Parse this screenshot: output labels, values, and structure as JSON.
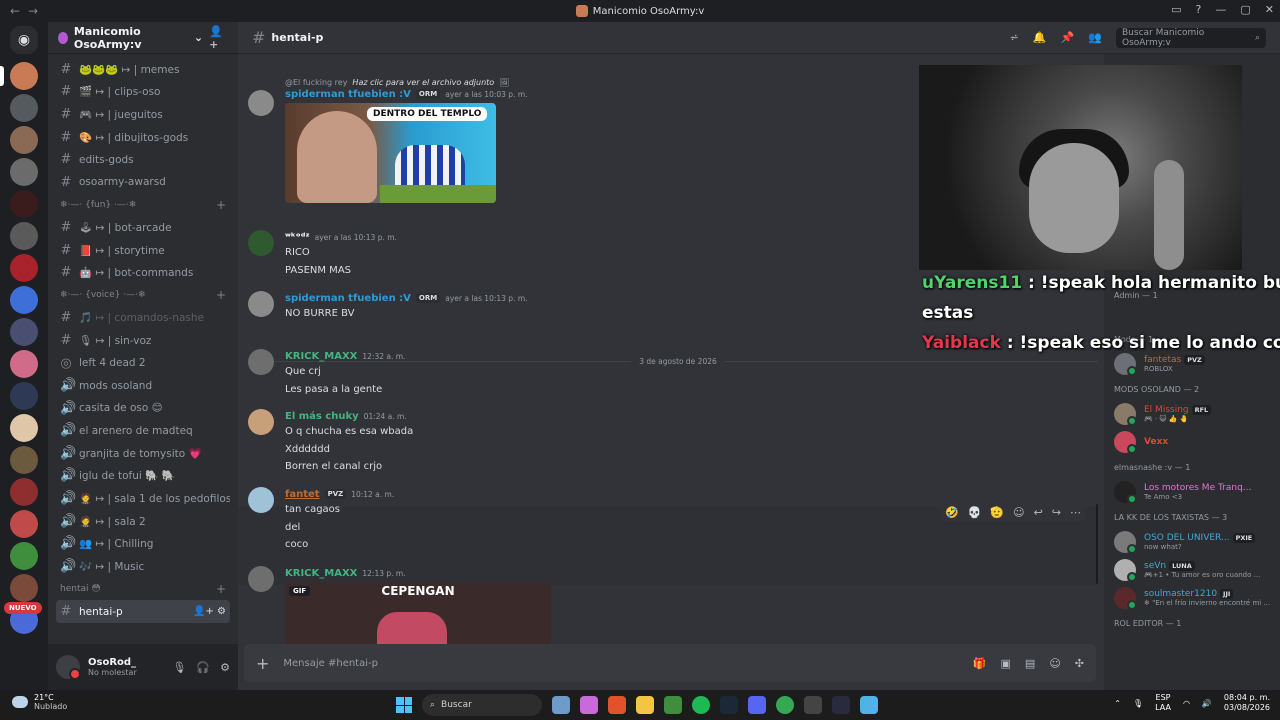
{
  "window": {
    "title": "Manicomio OsoArmy:v",
    "controls": [
      "▭",
      "?",
      "—",
      "▢",
      "✕"
    ]
  },
  "server": {
    "name": "Manicomio OsoArmy:v"
  },
  "channels": [
    {
      "kind": "text",
      "label": "🐸🐸🐸 ↦ | memes"
    },
    {
      "kind": "text",
      "label": "🎬 ↦ | clips-oso"
    },
    {
      "kind": "text",
      "label": "🎮 ↦ | jueguitos"
    },
    {
      "kind": "text",
      "label": "🎨 ↦ | dibujitos-gods"
    },
    {
      "kind": "text",
      "label": "edits-gods"
    },
    {
      "kind": "text",
      "label": "osoarmy-awarsd"
    },
    {
      "kind": "cat",
      "label": "❄·—· {fun} ·—·❄"
    },
    {
      "kind": "text",
      "label": "🕹 ↦ | bot-arcade"
    },
    {
      "kind": "text",
      "label": "📕 ↦ | storytime"
    },
    {
      "kind": "text",
      "label": "🤖 ↦ | bot-commands"
    },
    {
      "kind": "cat",
      "label": "❄·—· {voice} ·—·❄"
    },
    {
      "kind": "text-muted",
      "label": "🎵 ↦ | comandos-nashe"
    },
    {
      "kind": "text",
      "label": "🎙 ↦ | sin-voz"
    },
    {
      "kind": "stage",
      "label": "left 4 dead 2"
    },
    {
      "kind": "voice",
      "label": "mods osoland"
    },
    {
      "kind": "voice",
      "label": "casita de oso 😊"
    },
    {
      "kind": "voice",
      "label": "el arenero de madteq"
    },
    {
      "kind": "voice",
      "label": "granjita de tomysito 💗"
    },
    {
      "kind": "voice",
      "label": "iglu de tofui 🐘 🐘"
    },
    {
      "kind": "voice",
      "label": "🤵 ↦ | sala 1 de los pedofilos"
    },
    {
      "kind": "voice",
      "label": "🤵 ↦ | sala 2"
    },
    {
      "kind": "voice",
      "label": "👥 ↦ | Chilling"
    },
    {
      "kind": "voice",
      "label": "🎶 ↦ | Music"
    },
    {
      "kind": "cat",
      "label": "hentai 😳"
    },
    {
      "kind": "active",
      "label": "hentai-p"
    }
  ],
  "user": {
    "name": "OsoRod_",
    "status": "No molestar"
  },
  "nuevo_badge": "NUEVO",
  "channel_header": {
    "name": "hentai-p",
    "search_placeholder": "Buscar Manicomio OsoArmy:v"
  },
  "messages": {
    "reply_author": "@El fucking rey",
    "reply_text": "Haz clic para ver el archivo adjunto",
    "m1": {
      "user": "spiderman tfuebien :V",
      "tag": "ORM",
      "time": "ayer a las 10:03 p. m.",
      "image_caption": "DENTRO DEL TEMPLO"
    },
    "m2": {
      "user": "ʷᵏᵒᵈᶻ",
      "time": "ayer a las 10:13 p. m.",
      "lines": [
        "RICO",
        "PASENM MAS"
      ]
    },
    "m3": {
      "user": "spiderman tfuebien :V",
      "tag": "ORM",
      "time": "ayer a las 10:13 p. m.",
      "lines": [
        "NO BURRE  BV"
      ]
    },
    "divider": "3 de agosto de 2026",
    "m4": {
      "user": "KRICK_MAXX",
      "time": "12:32 a. m.",
      "lines": [
        "Que crj",
        "Les pasa a la gente"
      ]
    },
    "m5": {
      "user": "El más chuky",
      "time": "01:24 a. m.",
      "lines": [
        "O q chucha es esa wbada",
        "Xdddddd",
        "Borren el canal crjo"
      ]
    },
    "m6": {
      "user": "fantet",
      "tag": "PVZ",
      "time": "10:12 a. m.",
      "lines": [
        "tan cagaos",
        "del",
        "coco"
      ]
    },
    "m7": {
      "user": "KRICK_MAXX",
      "time": "12:13 p. m.",
      "gif_label": "GIF",
      "gif_caption": "CEPENGAN"
    }
  },
  "hover_actions": [
    "🤣",
    "💀",
    "🫡",
    "☺",
    "↩",
    "↪",
    "⋯"
  ],
  "composer": {
    "placeholder": "Mensaje #hentai-p"
  },
  "overlay_chat": [
    {
      "user": "uYarens11",
      "color": "#4fd36b",
      "text": " : !speak hola hermanito buenas"
    },
    {
      "user": "",
      "color": "#ffffff",
      "text": "estas"
    },
    {
      "user": "Yaiblack",
      "color": "#e8354f",
      "text": " : !speak eso si me lo ando comiendo"
    }
  ],
  "members": {
    "admin_cat": "Admin — 1",
    "mods_cat": "Mods — 1",
    "mods_member": {
      "name": "fantetas",
      "tag": "PVZ",
      "status": "ROBLOX"
    },
    "modsoland_cat": "MODS OSOLAND — 2",
    "modsoland_members": [
      {
        "name": "El Missing",
        "tag": "RFL",
        "status": "🎮 · 😺 👍 🤚"
      },
      {
        "name": "Vexx",
        "tag": "",
        "status": ""
      }
    ],
    "elmasnashe_cat": "elmasnashe :v — 1",
    "elmasnashe_member": {
      "name": "Los motores Me Tranq...",
      "status": "Te Amo <3"
    },
    "taxistas_cat": "LA KK DE LOS TAXISTAS — 3",
    "taxistas": [
      {
        "name": "OSO DEL UNIVER...",
        "tag": "PXIE",
        "status": "now what?"
      },
      {
        "name": "seVn",
        "tag": "LUNA",
        "status": "🎮+1 • Tu amor es oro cuando ..."
      },
      {
        "name": "soulmaster1210",
        "tag": "JJI",
        "status": "❄ \"En el frío invierno encontré mi ..."
      }
    ],
    "editor_cat": "ROL EDITOR — 1"
  },
  "taskbar": {
    "temp": "21°C",
    "weather": "Nublado",
    "search": "Buscar",
    "lang1": "ESP",
    "lang2": "LAA",
    "time": "08:04 p. m.",
    "date": "03/08/2026"
  },
  "colors": {
    "spider": "#2f9bd4",
    "wkodz": "#ffffff",
    "krick": "#43b581",
    "chuky": "#43b581",
    "fantet": "#c26b2e"
  }
}
